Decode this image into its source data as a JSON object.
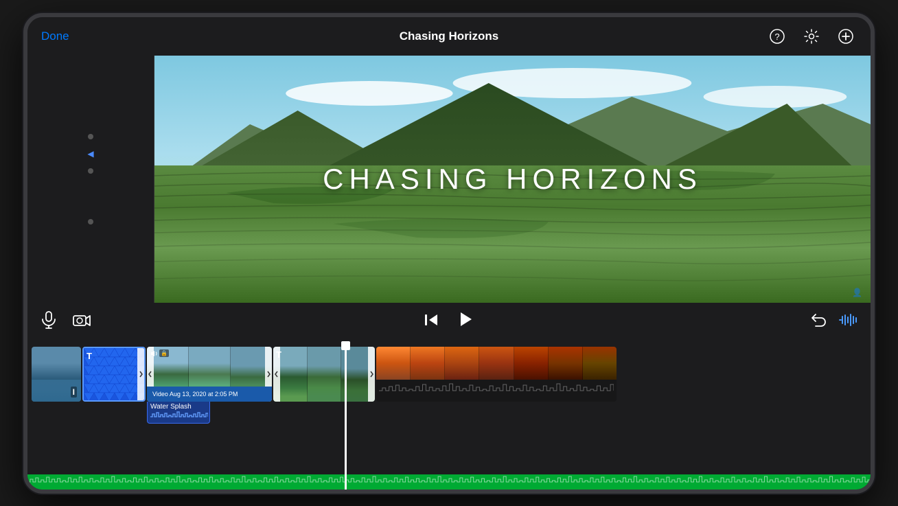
{
  "tablet": {
    "frame_color": "#2a2a2e",
    "border_color": "#3a3a3e"
  },
  "header": {
    "done_label": "Done",
    "title": "Chasing Horizons",
    "help_icon": "?",
    "settings_icon": "⚙",
    "add_icon": "+"
  },
  "preview": {
    "video_title": "CHASING HORIZONS"
  },
  "controls": {
    "microphone_icon": "mic",
    "camera_icon": "camera",
    "skip_back_icon": "skip-back",
    "play_icon": "▶",
    "undo_icon": "undo",
    "waveform_icon": "waveform"
  },
  "timeline": {
    "clips": [
      {
        "id": "clip-1",
        "type": "video",
        "label": "",
        "style": "lake"
      },
      {
        "id": "clip-2",
        "type": "title",
        "label": "Water Splash",
        "style": "blue-triangles"
      },
      {
        "id": "clip-3",
        "type": "video-audio",
        "label": "Video Aug 13, 2020 at 2:05 PM",
        "style": "landscape"
      },
      {
        "id": "clip-4",
        "type": "title-video",
        "label": "",
        "style": "landscape2"
      },
      {
        "id": "clip-5",
        "type": "video",
        "label": "",
        "style": "sunset"
      }
    ],
    "playhead_position": "middle"
  }
}
